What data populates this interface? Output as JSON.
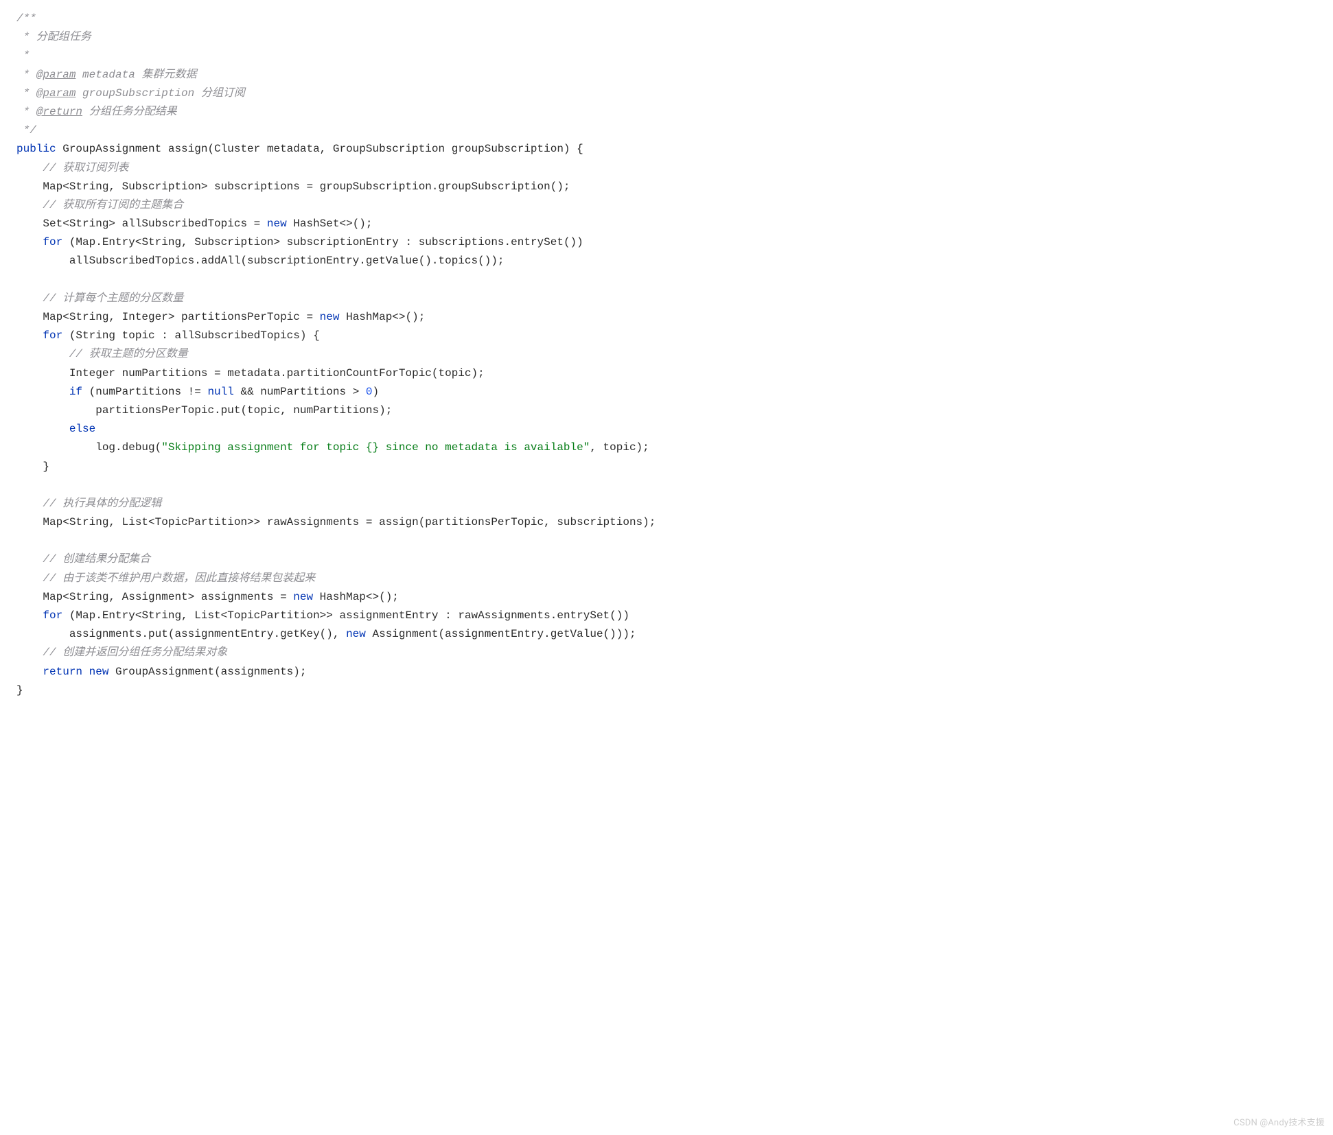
{
  "code": {
    "doc": {
      "open": "/**",
      "l1": " * 分配组任务",
      "l2": " *",
      "l3_prefix": " * ",
      "l3_tag": "@param",
      "l3_rest": " metadata 集群元数据",
      "l4_prefix": " * ",
      "l4_tag": "@param",
      "l4_rest": " groupSubscription 分组订阅",
      "l5_prefix": " * ",
      "l5_tag": "@return",
      "l5_rest": " 分组任务分配结果",
      "close": " */"
    },
    "sig": {
      "kw_public": "public",
      "rest": " GroupAssignment assign(Cluster metadata, GroupSubscription groupSubscription) {"
    },
    "body": {
      "c1": "    // 获取订阅列表",
      "l1": "    Map<String, Subscription> subscriptions = groupSubscription.groupSubscription();",
      "c2": "    // 获取所有订阅的主题集合",
      "l2a": "    Set<String> allSubscribedTopics = ",
      "l2_new": "new",
      "l2b": " HashSet<>();",
      "l3_for": "    for",
      "l3_rest": " (Map.Entry<String, Subscription> subscriptionEntry : subscriptions.entrySet())",
      "l4": "        allSubscribedTopics.addAll(subscriptionEntry.getValue().topics());",
      "blank1": "",
      "c3": "    // 计算每个主题的分区数量",
      "l5a": "    Map<String, Integer> partitionsPerTopic = ",
      "l5_new": "new",
      "l5b": " HashMap<>();",
      "l6_for": "    for",
      "l6_rest": " (String topic : allSubscribedTopics) {",
      "c4": "        // 获取主题的分区数量",
      "l7": "        Integer numPartitions = metadata.partitionCountForTopic(topic);",
      "l8_if": "        if",
      "l8_mid": " (numPartitions != ",
      "l8_null": "null",
      "l8_mid2": " && numPartitions > ",
      "l8_zero": "0",
      "l8_end": ")",
      "l9": "            partitionsPerTopic.put(topic, numPartitions);",
      "l10_else": "        else",
      "l11a": "            log.debug(",
      "l11_str": "\"Skipping assignment for topic {} since no metadata is available\"",
      "l11b": ", topic);",
      "l12": "    }",
      "blank2": "",
      "c5": "    // 执行具体的分配逻辑",
      "l13": "    Map<String, List<TopicPartition>> rawAssignments = assign(partitionsPerTopic, subscriptions);",
      "blank3": "",
      "c6": "    // 创建结果分配集合",
      "c7": "    // 由于该类不维护用户数据，因此直接将结果包装起来",
      "l14a": "    Map<String, Assignment> assignments = ",
      "l14_new": "new",
      "l14b": " HashMap<>();",
      "l15_for": "    for",
      "l15_rest": " (Map.Entry<String, List<TopicPartition>> assignmentEntry : rawAssignments.entrySet())",
      "l16a": "        assignments.put(assignmentEntry.getKey(), ",
      "l16_new": "new",
      "l16b": " Assignment(assignmentEntry.getValue()));",
      "c8": "    // 创建并返回分组任务分配结果对象",
      "l17_ret": "    return",
      "l17_sp": " ",
      "l17_new": "new",
      "l17b": " GroupAssignment(assignments);",
      "close": "}"
    }
  },
  "watermark": "CSDN @Andy技术支援"
}
